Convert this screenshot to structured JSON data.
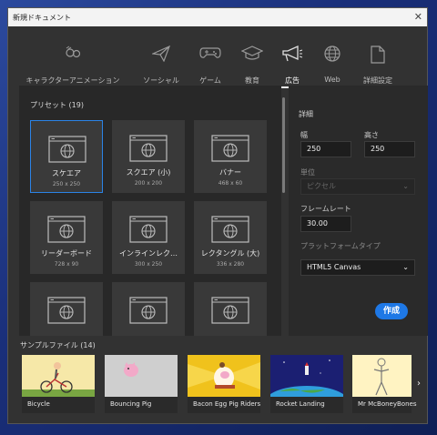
{
  "window": {
    "title": "新規ドキュメント",
    "close_glyph": "✕"
  },
  "categories": [
    {
      "label": "キャラクターアニメーション",
      "icon": "character-animation-icon"
    },
    {
      "label": "ソーシャル",
      "icon": "paper-plane-icon"
    },
    {
      "label": "ゲーム",
      "icon": "gamepad-icon"
    },
    {
      "label": "教育",
      "icon": "graduation-cap-icon"
    },
    {
      "label": "広告",
      "icon": "megaphone-icon",
      "active": true
    },
    {
      "label": "Web",
      "icon": "globe-icon"
    },
    {
      "label": "詳細設定",
      "icon": "document-icon"
    }
  ],
  "presets": {
    "heading": "プリセット (19)",
    "items": [
      {
        "name": "スケエア",
        "size": "250 x 250",
        "selected": true
      },
      {
        "name": "スクエア (小)",
        "size": "200 x 200"
      },
      {
        "name": "バナー",
        "size": "468 x 60"
      },
      {
        "name": "リーダーボード",
        "size": "728 x 90"
      },
      {
        "name": "インラインレク…",
        "size": "300 x 250"
      },
      {
        "name": "レクタングル (大)",
        "size": "336 x 280"
      },
      {
        "name": "",
        "size": ""
      },
      {
        "name": "",
        "size": ""
      },
      {
        "name": "",
        "size": ""
      }
    ]
  },
  "details": {
    "heading": "詳細",
    "width_label": "幅",
    "width_value": "250",
    "height_label": "高さ",
    "height_value": "250",
    "unit_label": "単位",
    "unit_value": "ピクセル",
    "framerate_label": "フレームレート",
    "framerate_value": "30.00",
    "platform_label": "プラットフォームタイプ",
    "platform_value": "HTML5 Canvas",
    "create_label": "作成"
  },
  "samples": {
    "heading": "サンプルファイル (14)",
    "items": [
      {
        "name": "Bicycle"
      },
      {
        "name": "Bouncing Pig"
      },
      {
        "name": "Bacon Egg Pig Riders"
      },
      {
        "name": "Rocket Landing"
      },
      {
        "name": "Mr McBoneyBones"
      }
    ],
    "next_glyph": "›"
  },
  "colors": {
    "accent": "#1e78e6",
    "panel": "#323232"
  }
}
